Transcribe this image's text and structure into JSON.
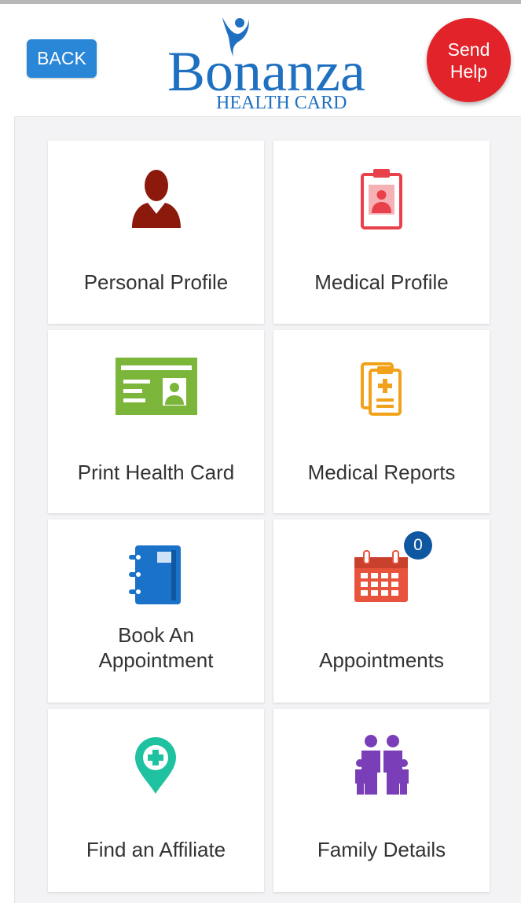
{
  "header": {
    "back_label": "BACK",
    "logo": {
      "name": "Bonanza",
      "subtitle": "HEALTH CARD"
    },
    "send_help": {
      "line1": "Send",
      "line2": "Help"
    }
  },
  "tiles": [
    {
      "label": "Personal Profile",
      "icon": "person-icon",
      "color": "#8b1a0c"
    },
    {
      "label": "Medical Profile",
      "icon": "clipboard-profile-icon",
      "color": "#e8414b"
    },
    {
      "label": "Print Health Card",
      "icon": "id-card-icon",
      "color": "#7bb53a"
    },
    {
      "label": "Medical Reports",
      "icon": "medical-report-icon",
      "color": "#f2a21a"
    },
    {
      "label": "Book An Appointment",
      "label_line1": "Book An",
      "label_line2": "Appointment",
      "icon": "notebook-icon",
      "color": "#1a73c9"
    },
    {
      "label": "Appointments",
      "icon": "calendar-icon",
      "color": "#e8533c",
      "badge": "0"
    },
    {
      "label": "Find an Affiliate",
      "icon": "location-pin-icon",
      "color": "#1fc2a0"
    },
    {
      "label": "Family Details",
      "icon": "family-icon",
      "color": "#7a3fb8"
    }
  ],
  "colors": {
    "back_button": "#2a86d6",
    "send_help": "#e2232a",
    "badge": "#0f57a0",
    "logo_blue": "#1f70c1"
  }
}
